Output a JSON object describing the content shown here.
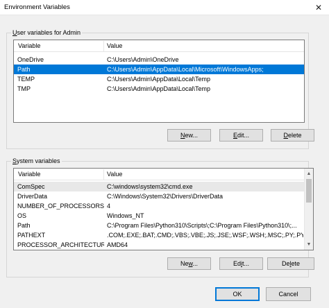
{
  "window": {
    "title": "Environment Variables",
    "close_glyph": "✕"
  },
  "user_group": {
    "legend_prefix": "",
    "legend_u": "U",
    "legend_rest": "ser variables for Admin",
    "columns": [
      "Variable",
      "Value"
    ],
    "rows": [
      {
        "variable": "OneDrive",
        "value": "C:\\Users\\Admin\\OneDrive"
      },
      {
        "variable": "Path",
        "value": "C:\\Users\\Admin\\AppData\\Local\\Microsoft\\WindowsApps;",
        "selected": true
      },
      {
        "variable": "TEMP",
        "value": "C:\\Users\\Admin\\AppData\\Local\\Temp"
      },
      {
        "variable": "TMP",
        "value": "C:\\Users\\Admin\\AppData\\Local\\Temp"
      }
    ],
    "buttons": {
      "new": {
        "u": "N",
        "rest": "ew..."
      },
      "edit": {
        "u": "E",
        "rest": "dit..."
      },
      "delete": {
        "u": "D",
        "rest": "elete"
      }
    }
  },
  "system_group": {
    "legend_u": "S",
    "legend_rest": "ystem variables",
    "columns": [
      "Variable",
      "Value"
    ],
    "rows": [
      {
        "variable": "ComSpec",
        "value": "C:\\windows\\system32\\cmd.exe"
      },
      {
        "variable": "DriverData",
        "value": "C:\\Windows\\System32\\Drivers\\DriverData"
      },
      {
        "variable": "NUMBER_OF_PROCESSORS",
        "value": "4"
      },
      {
        "variable": "OS",
        "value": "Windows_NT"
      },
      {
        "variable": "Path",
        "value": "C:\\Program Files\\Python310\\Scripts\\;C:\\Program Files\\Python310\\;..."
      },
      {
        "variable": "PATHEXT",
        "value": ".COM;.EXE;.BAT;.CMD;.VBS;.VBE;.JS;.JSE;.WSF;.WSH;.MSC;.PY;.PYW"
      },
      {
        "variable": "PROCESSOR_ARCHITECTURE",
        "value": "AMD64"
      }
    ],
    "buttons": {
      "new": {
        "pre": "Ne",
        "u": "w",
        "rest": "..."
      },
      "edit": {
        "pre": "Ed",
        "u": "i",
        "rest": "t..."
      },
      "delete": {
        "pre": "De",
        "u": "l",
        "rest": "ete"
      }
    },
    "scrollbar": {
      "up": "▲",
      "down": "▼"
    }
  },
  "footer": {
    "ok": "OK",
    "cancel": "Cancel"
  },
  "colors": {
    "selection": "#0078d7",
    "default_border": "#0078d7"
  }
}
